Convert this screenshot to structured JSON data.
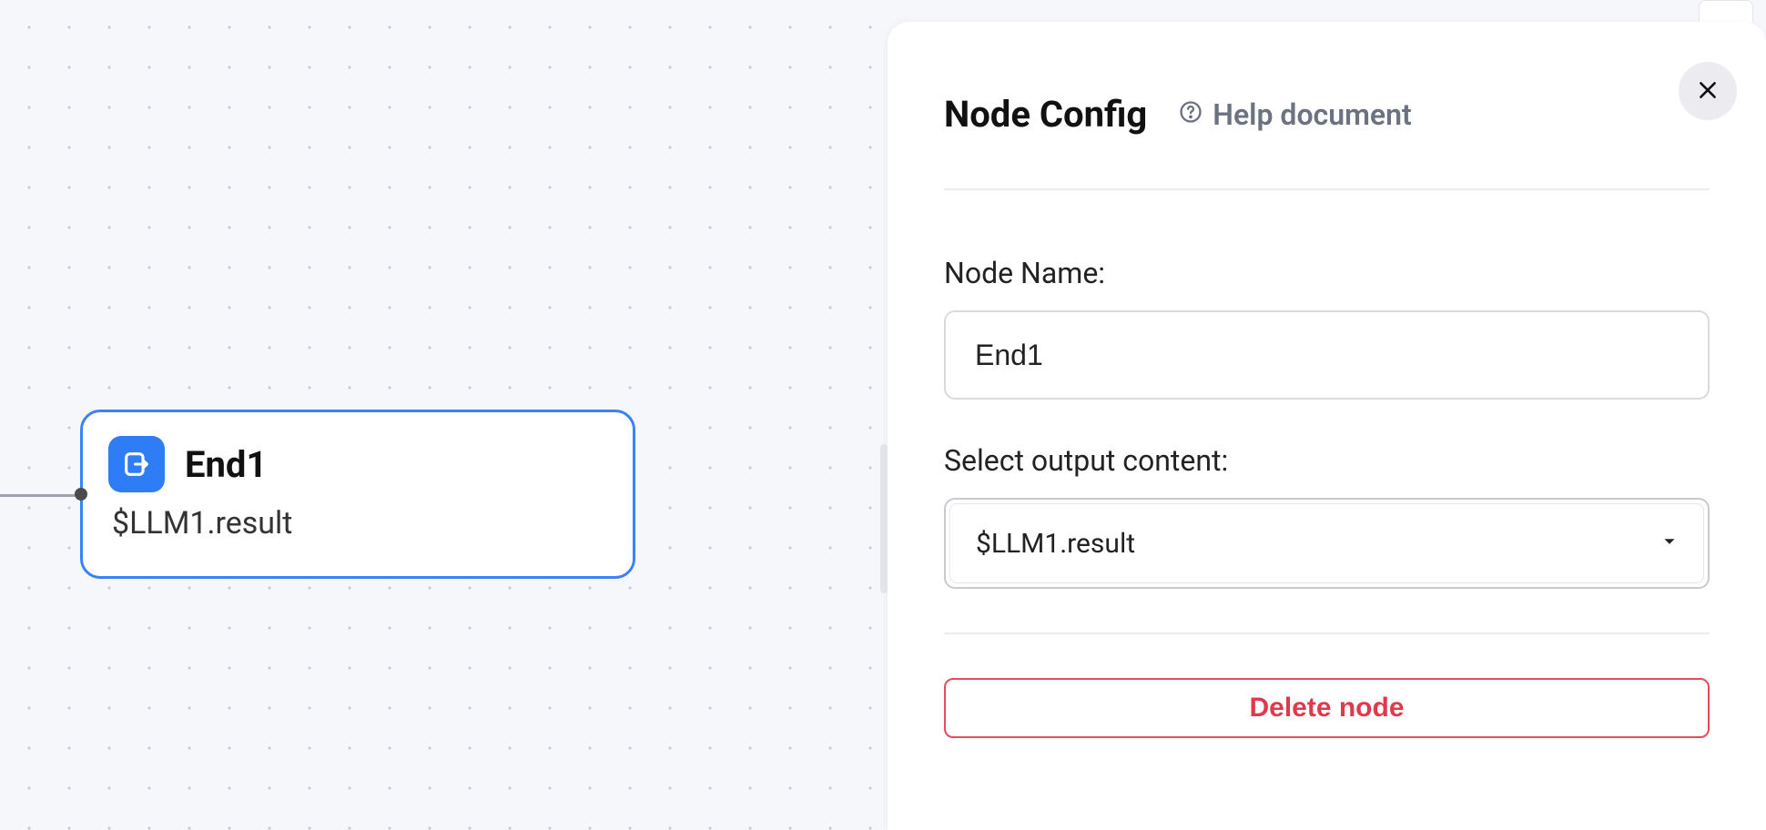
{
  "canvas": {
    "node": {
      "title": "End1",
      "subtitle": "$LLM1.result",
      "icon": "end-icon"
    }
  },
  "panel": {
    "title": "Node Config",
    "help_label": "Help document",
    "close_icon": "close-icon",
    "fields": {
      "node_name": {
        "label": "Node Name:",
        "value": "End1"
      },
      "output": {
        "label": "Select output content:",
        "value": "$LLM1.result"
      }
    },
    "delete_label": "Delete node"
  }
}
